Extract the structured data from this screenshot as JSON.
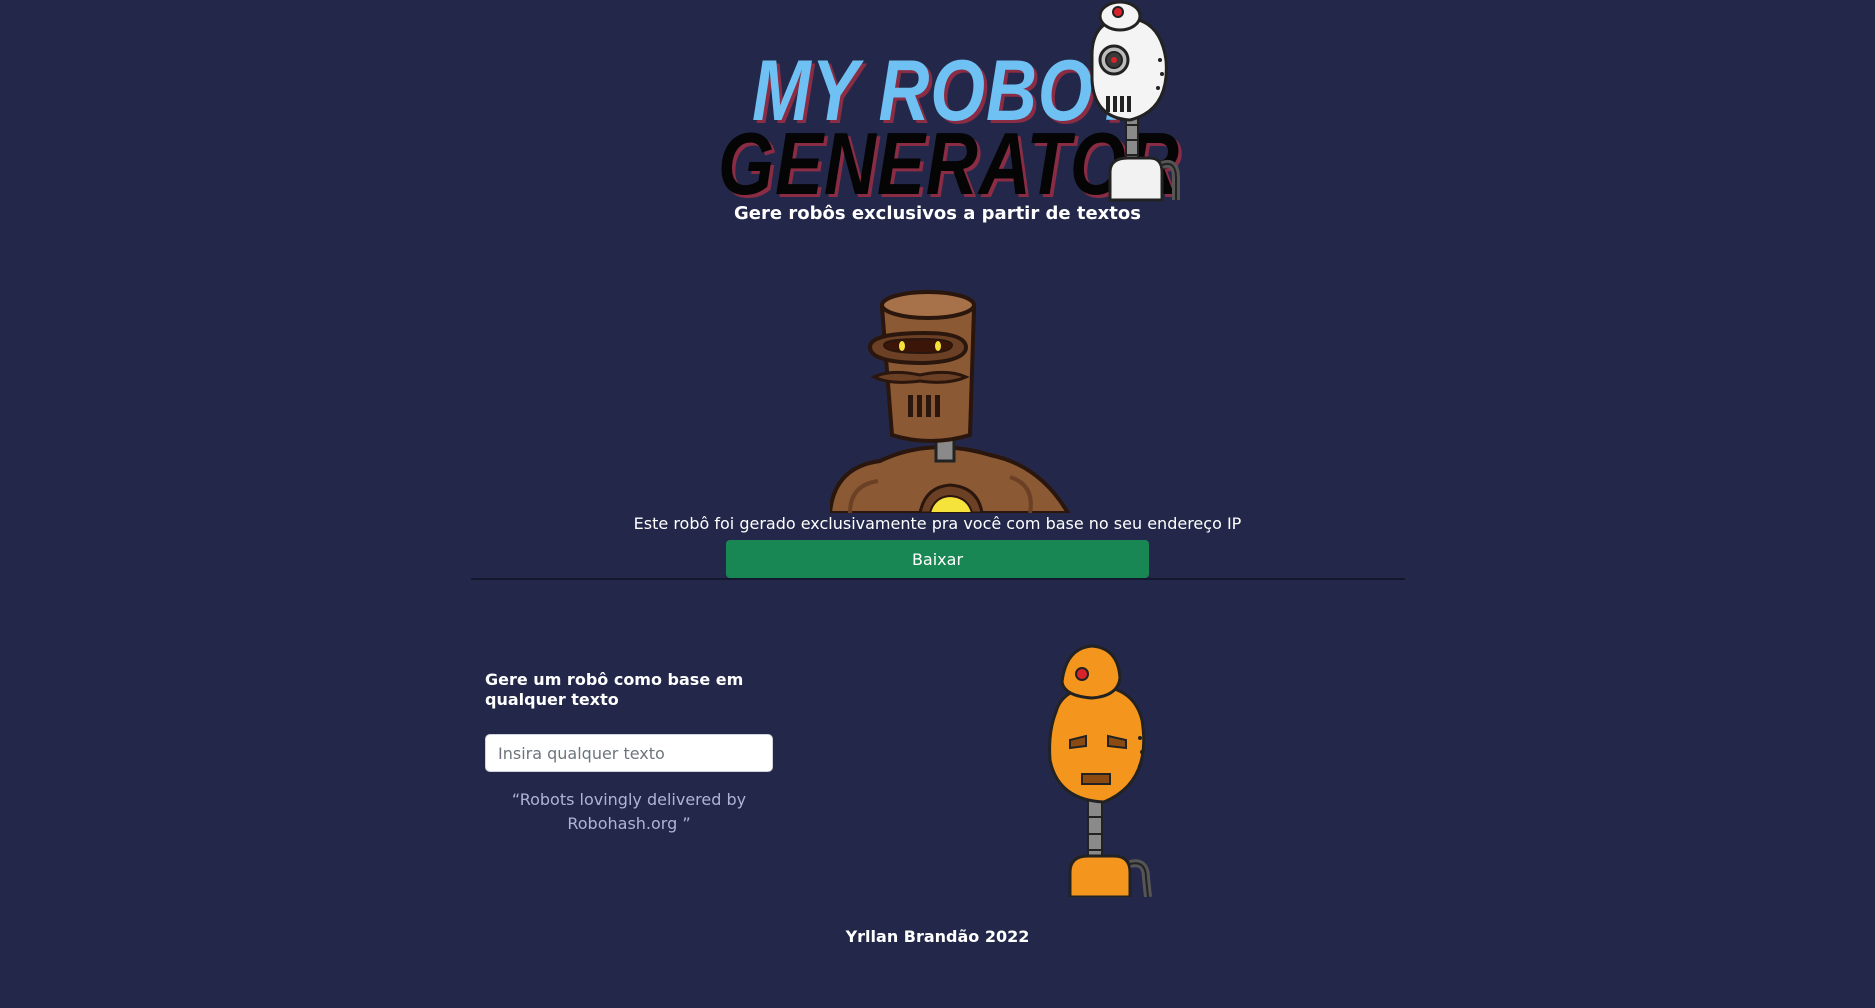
{
  "header": {
    "logo_line1": "MY ROBOT",
    "logo_line2": "GENERATOR",
    "subtitle": "Gere robôs exclusivos a partir de textos"
  },
  "ip_section": {
    "message": "Este robô foi gerado exclusivamente pra você com base no seu endereço IP",
    "download_label": "Baixar"
  },
  "generator": {
    "label": "Gere um robô como base em qualquer texto",
    "input_placeholder": "Insira qualquer texto",
    "input_value": "",
    "credit": "“Robots lovingly delivered by Robohash.org ”"
  },
  "footer": {
    "text": "Yrllan Brandão 2022"
  },
  "colors": {
    "background": "#23284a",
    "logo_blue": "#6fc1f3",
    "logo_black": "#050505",
    "button_green": "#198754",
    "credit_text": "#aeb4d6"
  },
  "icons": {
    "logo_robot": "white-robot-icon",
    "ip_robot": "brown-robot-icon",
    "text_robot": "orange-robot-icon"
  }
}
